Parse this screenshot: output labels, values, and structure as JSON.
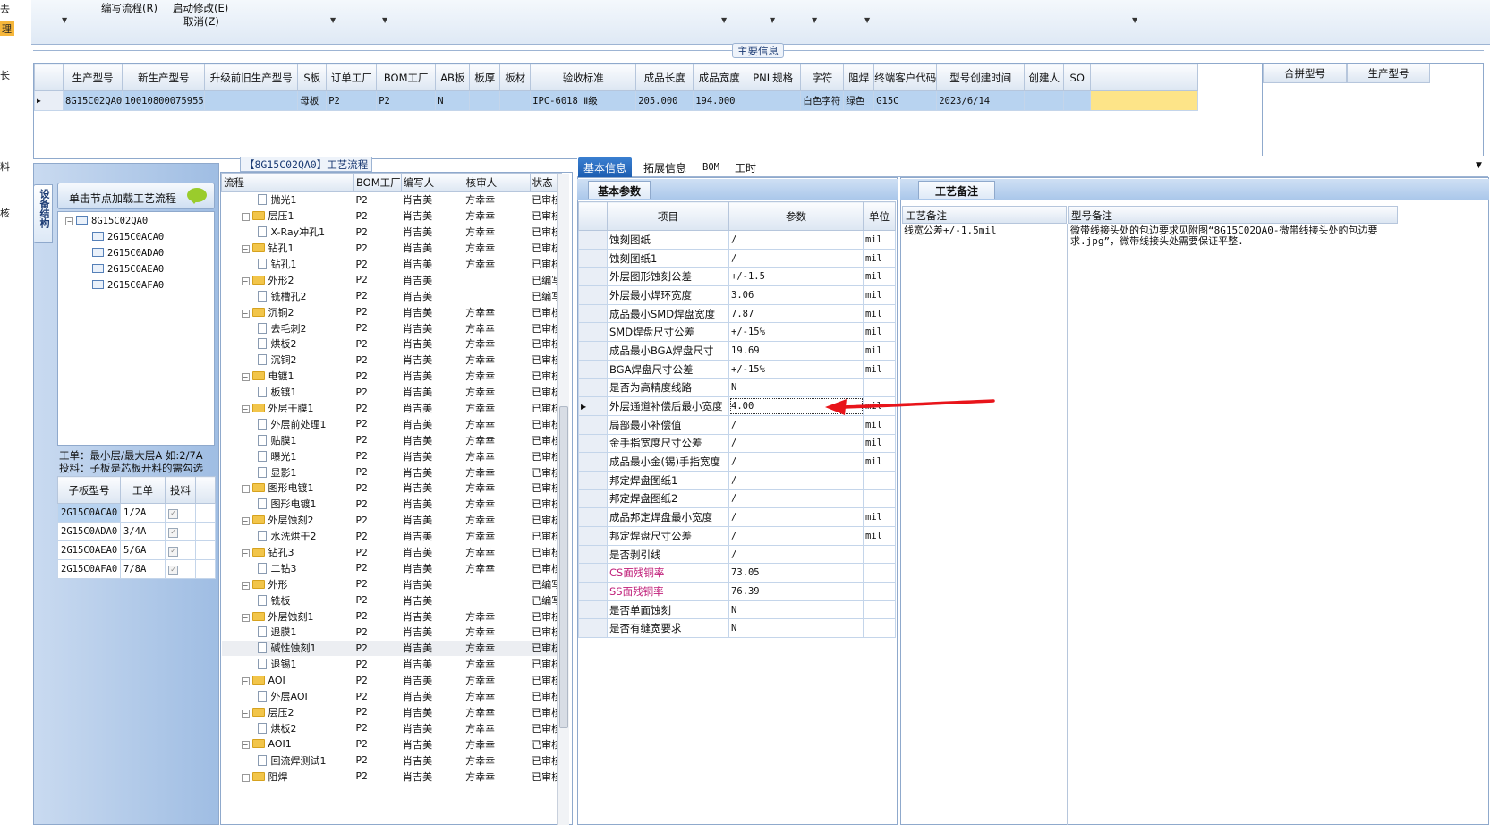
{
  "left_strip": {
    "items": [
      "去",
      "理",
      "长",
      "料",
      "核"
    ]
  },
  "toolbar": {
    "write_flow": "编写流程(R)",
    "start_modify": "启动修改(E)",
    "cancel": "取消(Z)"
  },
  "main_group": {
    "title": "主要信息"
  },
  "main_table": {
    "headers": [
      "生产型号",
      "新生产型号",
      "升级前旧生产型号",
      "S板",
      "订单工厂",
      "BOM工厂",
      "AB板",
      "板厚",
      "板材",
      "验收标准",
      "成品长度",
      "成品宽度",
      "PNL规格",
      "字符",
      "阻焊",
      "终端客户代码",
      "型号创建时间",
      "创建人",
      "SO"
    ],
    "row": [
      "8G15C02QA0",
      "10010800075955",
      "",
      "母板",
      "P2",
      "P2",
      "N",
      "",
      "",
      "IPC-6018 Ⅱ级",
      "205.000",
      "194.000",
      "",
      "白色字符",
      "绿色",
      "G15C",
      "2023/6/14",
      "",
      ""
    ]
  },
  "merge_box": {
    "headers": [
      "合拼型号",
      "生产型号"
    ]
  },
  "left_panel": {
    "vertical_tab": "设备结构",
    "load_button": "单击节点加载工艺流程",
    "tree": {
      "root": "8G15C02QA0",
      "children": [
        "2G15C0ACA0",
        "2G15C0ADA0",
        "2G15C0AEA0",
        "2G15C0AFA0"
      ]
    },
    "note_line1": "工单：最小层/最大层A 如:2/7A",
    "note_line2": "投料：子板是芯板开料的需勾选",
    "sub_table": {
      "headers": [
        "子板型号",
        "工单",
        "投料"
      ],
      "rows": [
        [
          "2G15C0ACA0",
          "1/2A"
        ],
        [
          "2G15C0ADA0",
          "3/4A"
        ],
        [
          "2G15C0AEA0",
          "5/6A"
        ],
        [
          "2G15C0AFA0",
          "7/8A"
        ]
      ]
    }
  },
  "flow": {
    "title": "【8G15C02QA0】工艺流程",
    "headers": [
      "流程",
      "BOM工厂",
      "编写人",
      "核审人",
      "状态"
    ],
    "rows": [
      {
        "name": "抛光1",
        "level": 2,
        "bom": "P2",
        "writer": "肖吉美",
        "reviewer": "方幸幸",
        "status": "已审核"
      },
      {
        "name": "层压1",
        "level": 1,
        "bom": "P2",
        "writer": "肖吉美",
        "reviewer": "方幸幸",
        "status": "已审核"
      },
      {
        "name": "X-Ray冲孔1",
        "level": 2,
        "bom": "P2",
        "writer": "肖吉美",
        "reviewer": "方幸幸",
        "status": "已审核"
      },
      {
        "name": "钻孔1",
        "level": 1,
        "bom": "P2",
        "writer": "肖吉美",
        "reviewer": "方幸幸",
        "status": "已审核"
      },
      {
        "name": "钻孔1",
        "level": 2,
        "bom": "P2",
        "writer": "肖吉美",
        "reviewer": "方幸幸",
        "status": "已审核"
      },
      {
        "name": "外形2",
        "level": 1,
        "bom": "P2",
        "writer": "肖吉美",
        "reviewer": "",
        "status": "已编写"
      },
      {
        "name": "铣槽孔2",
        "level": 2,
        "bom": "P2",
        "writer": "肖吉美",
        "reviewer": "",
        "status": "已编写"
      },
      {
        "name": "沉铜2",
        "level": 1,
        "bom": "P2",
        "writer": "肖吉美",
        "reviewer": "方幸幸",
        "status": "已审核"
      },
      {
        "name": "去毛刺2",
        "level": 2,
        "bom": "P2",
        "writer": "肖吉美",
        "reviewer": "方幸幸",
        "status": "已审核"
      },
      {
        "name": "烘板2",
        "level": 2,
        "bom": "P2",
        "writer": "肖吉美",
        "reviewer": "方幸幸",
        "status": "已审核"
      },
      {
        "name": "沉铜2",
        "level": 2,
        "bom": "P2",
        "writer": "肖吉美",
        "reviewer": "方幸幸",
        "status": "已审核"
      },
      {
        "name": "电镀1",
        "level": 1,
        "bom": "P2",
        "writer": "肖吉美",
        "reviewer": "方幸幸",
        "status": "已审核"
      },
      {
        "name": "板镀1",
        "level": 2,
        "bom": "P2",
        "writer": "肖吉美",
        "reviewer": "方幸幸",
        "status": "已审核"
      },
      {
        "name": "外层干膜1",
        "level": 1,
        "bom": "P2",
        "writer": "肖吉美",
        "reviewer": "方幸幸",
        "status": "已审核"
      },
      {
        "name": "外层前处理1",
        "level": 2,
        "bom": "P2",
        "writer": "肖吉美",
        "reviewer": "方幸幸",
        "status": "已审核"
      },
      {
        "name": "贴膜1",
        "level": 2,
        "bom": "P2",
        "writer": "肖吉美",
        "reviewer": "方幸幸",
        "status": "已审核"
      },
      {
        "name": "曝光1",
        "level": 2,
        "bom": "P2",
        "writer": "肖吉美",
        "reviewer": "方幸幸",
        "status": "已审核"
      },
      {
        "name": "显影1",
        "level": 2,
        "bom": "P2",
        "writer": "肖吉美",
        "reviewer": "方幸幸",
        "status": "已审核"
      },
      {
        "name": "图形电镀1",
        "level": 1,
        "bom": "P2",
        "writer": "肖吉美",
        "reviewer": "方幸幸",
        "status": "已审核"
      },
      {
        "name": "图形电镀1",
        "level": 2,
        "bom": "P2",
        "writer": "肖吉美",
        "reviewer": "方幸幸",
        "status": "已审核"
      },
      {
        "name": "外层蚀刻2",
        "level": 1,
        "bom": "P2",
        "writer": "肖吉美",
        "reviewer": "方幸幸",
        "status": "已审核"
      },
      {
        "name": "水洗烘干2",
        "level": 2,
        "bom": "P2",
        "writer": "肖吉美",
        "reviewer": "方幸幸",
        "status": "已审核"
      },
      {
        "name": "钻孔3",
        "level": 1,
        "bom": "P2",
        "writer": "肖吉美",
        "reviewer": "方幸幸",
        "status": "已审核"
      },
      {
        "name": "二钻3",
        "level": 2,
        "bom": "P2",
        "writer": "肖吉美",
        "reviewer": "方幸幸",
        "status": "已审核"
      },
      {
        "name": "外形",
        "level": 1,
        "bom": "P2",
        "writer": "肖吉美",
        "reviewer": "",
        "status": "已编写"
      },
      {
        "name": "铣板",
        "level": 2,
        "bom": "P2",
        "writer": "肖吉美",
        "reviewer": "",
        "status": "已编写"
      },
      {
        "name": "外层蚀刻1",
        "level": 1,
        "bom": "P2",
        "writer": "肖吉美",
        "reviewer": "方幸幸",
        "status": "已审核"
      },
      {
        "name": "退膜1",
        "level": 2,
        "bom": "P2",
        "writer": "肖吉美",
        "reviewer": "方幸幸",
        "status": "已审核"
      },
      {
        "name": "碱性蚀刻1",
        "level": 2,
        "bom": "P2",
        "writer": "肖吉美",
        "reviewer": "方幸幸",
        "status": "已审核",
        "highlight": true
      },
      {
        "name": "退锡1",
        "level": 2,
        "bom": "P2",
        "writer": "肖吉美",
        "reviewer": "方幸幸",
        "status": "已审核"
      },
      {
        "name": "AOI",
        "level": 1,
        "bom": "P2",
        "writer": "肖吉美",
        "reviewer": "方幸幸",
        "status": "已审核"
      },
      {
        "name": "外层AOI",
        "level": 2,
        "bom": "P2",
        "writer": "肖吉美",
        "reviewer": "方幸幸",
        "status": "已审核"
      },
      {
        "name": "层压2",
        "level": 1,
        "bom": "P2",
        "writer": "肖吉美",
        "reviewer": "方幸幸",
        "status": "已审核"
      },
      {
        "name": "烘板2",
        "level": 2,
        "bom": "P2",
        "writer": "肖吉美",
        "reviewer": "方幸幸",
        "status": "已审核"
      },
      {
        "name": "AOI1",
        "level": 1,
        "bom": "P2",
        "writer": "肖吉美",
        "reviewer": "方幸幸",
        "status": "已审核"
      },
      {
        "name": "回流焊测试1",
        "level": 2,
        "bom": "P2",
        "writer": "肖吉美",
        "reviewer": "方幸幸",
        "status": "已审核"
      },
      {
        "name": "阻焊",
        "level": 1,
        "bom": "P2",
        "writer": "肖吉美",
        "reviewer": "方幸幸",
        "status": "已审核"
      }
    ]
  },
  "tabs": [
    "基本信息",
    "拓展信息",
    "BOM",
    "工时"
  ],
  "basic": {
    "title": "基本参数",
    "headers": [
      "项目",
      "参数",
      "单位"
    ],
    "rows": [
      {
        "item": "蚀刻图纸",
        "value": "/",
        "unit": "mil"
      },
      {
        "item": "蚀刻图纸1",
        "value": "/",
        "unit": "mil"
      },
      {
        "item": "外层图形蚀刻公差",
        "value": "+/-1.5",
        "unit": "mil"
      },
      {
        "item": "外层最小焊环宽度",
        "value": "3.06",
        "unit": "mil"
      },
      {
        "item": "成品最小SMD焊盘宽度",
        "value": "7.87",
        "unit": "mil"
      },
      {
        "item": "SMD焊盘尺寸公差",
        "value": "+/-15%",
        "unit": "mil"
      },
      {
        "item": "成品最小BGA焊盘尺寸",
        "value": "19.69",
        "unit": "mil"
      },
      {
        "item": "BGA焊盘尺寸公差",
        "value": "+/-15%",
        "unit": "mil"
      },
      {
        "item": "是否为高精度线路",
        "value": "N",
        "unit": ""
      },
      {
        "item": "外层通道补偿后最小宽度",
        "value": "4.00",
        "unit": "mil",
        "current": true
      },
      {
        "item": "局部最小补偿值",
        "value": "/",
        "unit": "mil"
      },
      {
        "item": "金手指宽度尺寸公差",
        "value": "/",
        "unit": "mil"
      },
      {
        "item": "成品最小金(锡)手指宽度",
        "value": "/",
        "unit": "mil"
      },
      {
        "item": "邦定焊盘图纸1",
        "value": "/",
        "unit": ""
      },
      {
        "item": "邦定焊盘图纸2",
        "value": "/",
        "unit": ""
      },
      {
        "item": "成品邦定焊盘最小宽度",
        "value": "/",
        "unit": "mil"
      },
      {
        "item": "邦定焊盘尺寸公差",
        "value": "/",
        "unit": "mil"
      },
      {
        "item": "是否剥引线",
        "value": "/",
        "unit": ""
      },
      {
        "item": "CS面残铜率",
        "value": "73.05",
        "unit": "",
        "pink": true
      },
      {
        "item": "SS面残铜率",
        "value": "76.39",
        "unit": "",
        "pink": true
      },
      {
        "item": "是否单面蚀刻",
        "value": "N",
        "unit": ""
      },
      {
        "item": "是否有缝宽要求",
        "value": "N",
        "unit": ""
      }
    ]
  },
  "notes": {
    "title": "工艺备注",
    "col1_header": "工艺备注",
    "col2_header": "型号备注",
    "process_note": "线宽公差+/-1.5mil",
    "model_note": "微带线接头处的包边要求见附图“8G15C02QA0-微带线接头处的包边要求.jpg”，微带线接头处需要保证平整."
  },
  "colors": {
    "selection": "#b8d3f0",
    "yellow_cell": "#fde488",
    "active_tab": "#1c5db1",
    "arrow": "#e8141a",
    "pink_text": "#c0207a"
  }
}
